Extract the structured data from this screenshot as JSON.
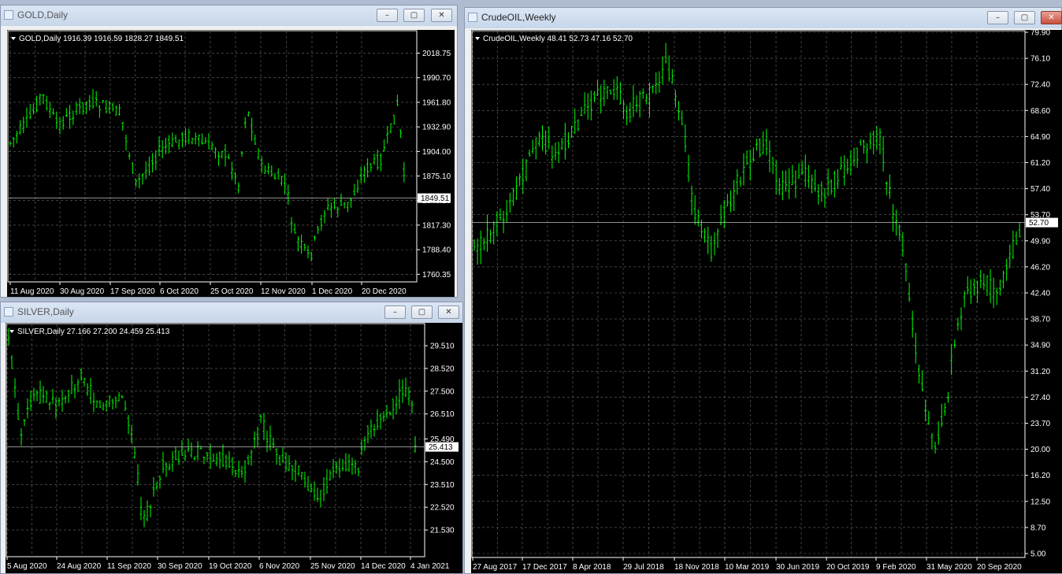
{
  "windows": [
    {
      "id": "gold",
      "title": "GOLD,Daily",
      "ohlc_line": "GOLD,Daily  1916.39 1916.59 1828.27 1849.51",
      "price_labels": [
        "2018.75",
        "1990.70",
        "1961.80",
        "1932.90",
        "1904.00",
        "1875.10",
        "1846.20",
        "1817.30",
        "1788.40",
        "1760.35"
      ],
      "time_labels": [
        "11 Aug 2020",
        "30 Aug 2020",
        "17 Sep 2020",
        "6 Oct 2020",
        "25 Oct 2020",
        "12 Nov 2020",
        "1 Dec 2020",
        "20 Dec 2020"
      ],
      "current_price": "1849.51",
      "colors": {
        "candle": "#00ff00",
        "grid": "#c0c0c0",
        "background": "#000000"
      }
    },
    {
      "id": "silver",
      "title": "SILVER,Daily",
      "ohlc_line": "SILVER,Daily  27.166 27.200 24.459 25.413",
      "price_labels": [
        "29.510",
        "28.520",
        "27.500",
        "26.510",
        "25.490",
        "24.500",
        "23.510",
        "22.520",
        "21.530"
      ],
      "time_labels": [
        "5 Aug 2020",
        "24 Aug 2020",
        "11 Sep 2020",
        "30 Sep 2020",
        "19 Oct 2020",
        "6 Nov 2020",
        "25 Nov 2020",
        "14 Dec 2020",
        "4 Jan 2021"
      ],
      "current_price": "25.413",
      "colors": {
        "candle": "#00ff00",
        "grid": "#c0c0c0",
        "background": "#000000"
      }
    },
    {
      "id": "crude",
      "title": "CrudeOIL,Weekly",
      "ohlc_line": "CrudeOIL,Weekly  48.41 52.73 47.16 52.70",
      "price_labels": [
        "79.90",
        "76.10",
        "72.40",
        "68.60",
        "64.90",
        "61.20",
        "57.40",
        "53.70",
        "49.90",
        "46.20",
        "42.40",
        "38.70",
        "34.90",
        "31.20",
        "27.40",
        "23.70",
        "20.00",
        "16.20",
        "12.50",
        "8.70",
        "5.00"
      ],
      "time_labels": [
        "27 Aug 2017",
        "17 Dec 2017",
        "8 Apr 2018",
        "29 Jul 2018",
        "18 Nov 2018",
        "10 Mar 2019",
        "30 Jun 2019",
        "20 Oct 2019",
        "9 Feb 2020",
        "31 May 2020",
        "20 Sep 2020"
      ],
      "current_price": "52.70",
      "colors": {
        "candle": "#00ff00",
        "grid": "#c0c0c0",
        "background": "#000000"
      }
    }
  ],
  "buttons": {
    "minimize": "–",
    "maximize": "▢",
    "close": "✕"
  }
}
